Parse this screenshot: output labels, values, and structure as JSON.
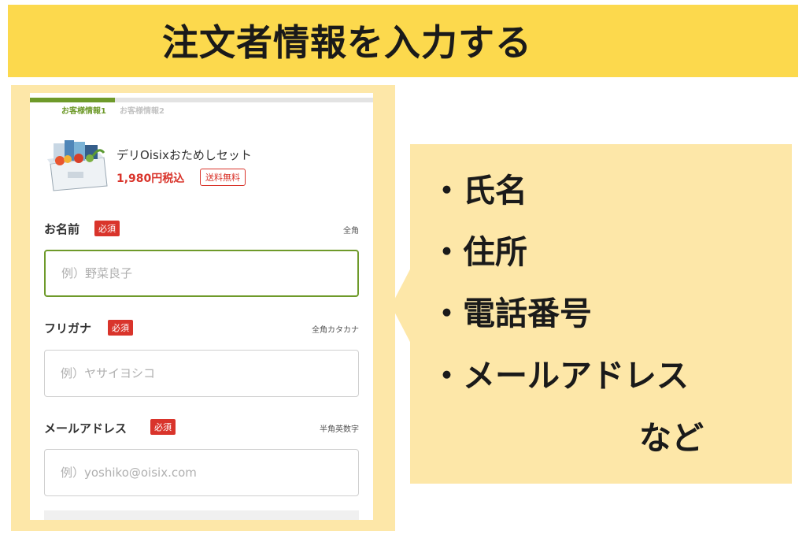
{
  "banner": {
    "title": "注文者情報を入力する"
  },
  "form": {
    "steps": [
      "お客様情報1",
      "お客様情報2"
    ],
    "product": {
      "name": "デリOisixおためしセット",
      "price": "1,980円税込",
      "badge": "送料無料"
    },
    "fields": [
      {
        "label": "お名前",
        "required": "必須",
        "note": "全角",
        "placeholder": "例）野菜良子"
      },
      {
        "label": "フリガナ",
        "required": "必須",
        "note": "全角カタカナ",
        "placeholder": "例）ヤサイヨシコ"
      },
      {
        "label": "メールアドレス",
        "required": "必須",
        "note": "半角英数字",
        "placeholder": "例）yoshiko@oisix.com"
      }
    ]
  },
  "callout": {
    "items": [
      "・氏名",
      "・住所",
      "・電話番号",
      "・メールアドレス"
    ],
    "suffix": "など"
  },
  "colors": {
    "banner": "#fcd94d",
    "callout": "#fde7a8",
    "accent_green": "#6e9a2a",
    "required_red": "#d9342b"
  }
}
